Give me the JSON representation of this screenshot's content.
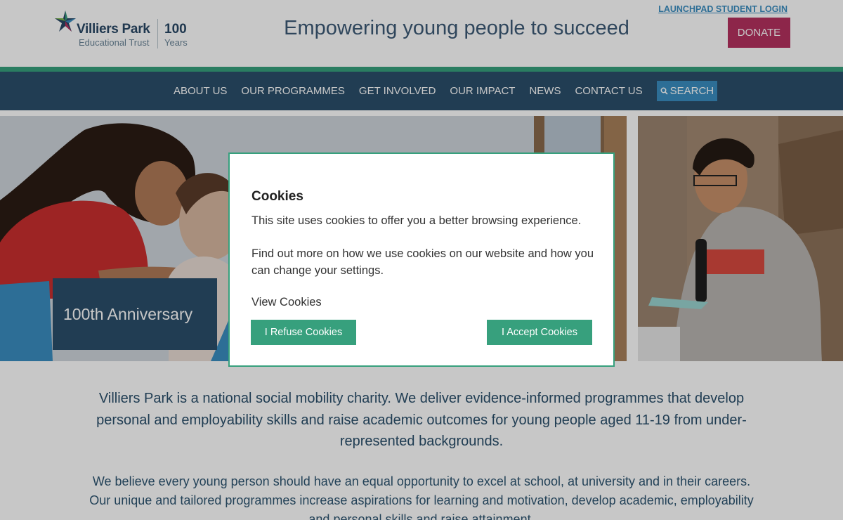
{
  "header": {
    "logo_name": "Villiers Park",
    "logo_sub": "Educational Trust",
    "logo_anniversary": "100",
    "logo_anniversary_sub": "Years",
    "tagline": "Empowering young people to succeed",
    "launchpad_link": "LAUNCHPAD STUDENT LOGIN",
    "donate_label": "DONATE"
  },
  "nav": {
    "items": [
      {
        "label": "ABOUT US"
      },
      {
        "label": "OUR PROGRAMMES"
      },
      {
        "label": "GET INVOLVED"
      },
      {
        "label": "OUR IMPACT"
      },
      {
        "label": "NEWS"
      },
      {
        "label": "CONTACT US"
      }
    ],
    "search_label": "SEARCH"
  },
  "hero": {
    "caption": "100th Anniversary"
  },
  "content": {
    "intro": "Villiers Park is a national social mobility charity. We deliver evidence-informed programmes that develop personal and employability skills and raise academic outcomes for young people aged 11-19 from under-represented backgrounds.",
    "body": "We believe every young person should have an equal opportunity to excel at school, at university and in their careers. Our unique and tailored programmes increase aspirations for learning and motivation, develop academic, employability and personal skills and raise attainment."
  },
  "cookie_modal": {
    "title": "Cookies",
    "paragraph1": "This site uses cookies to offer you a better browsing experience.",
    "paragraph2": "Find out more on how we use cookies on our website and how you can change your settings.",
    "view_link": "View Cookies",
    "refuse_label": "I Refuse Cookies",
    "accept_label": "I Accept Cookies"
  },
  "colors": {
    "brand_navy": "#2b4f6b",
    "brand_green": "#37a07d",
    "donate_pink": "#b5315f",
    "link_blue": "#3a8ec0"
  }
}
